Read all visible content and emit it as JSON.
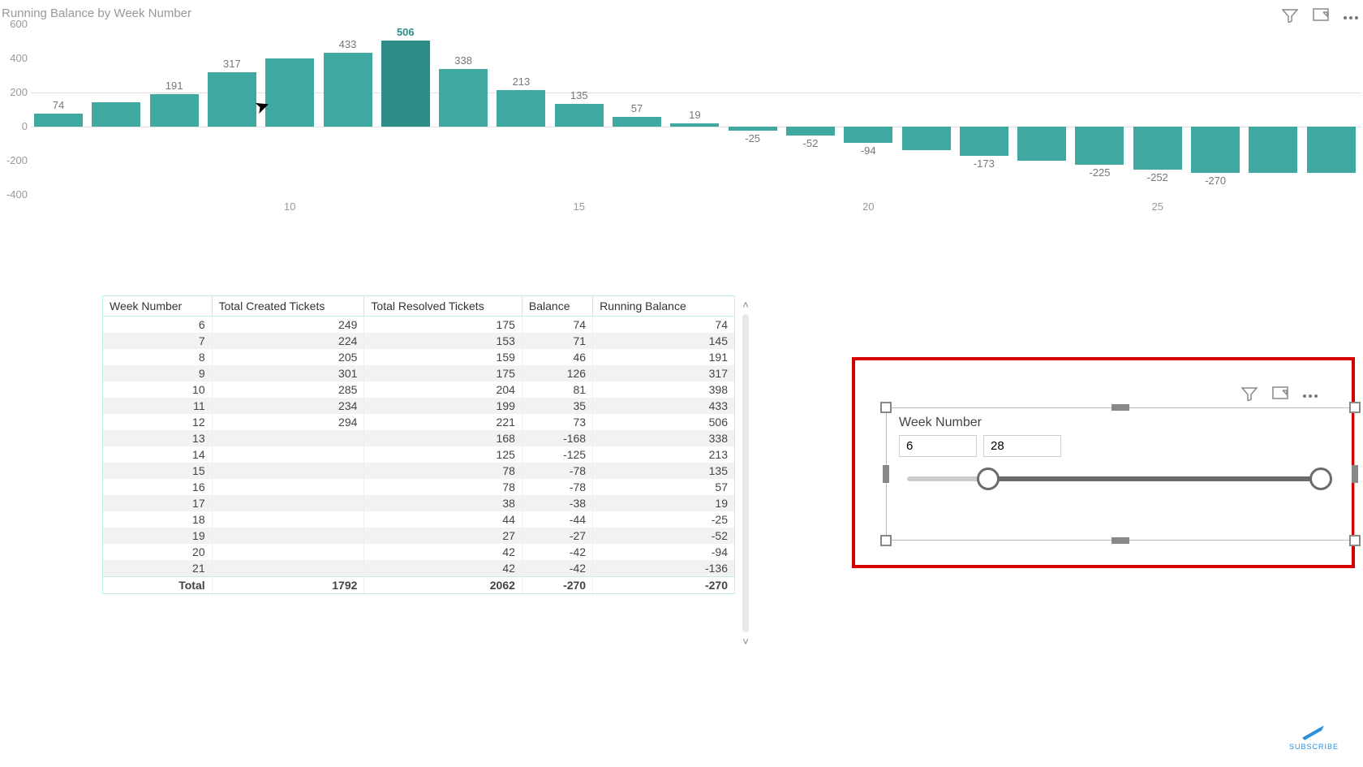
{
  "chart_data": {
    "type": "bar",
    "title": "Running Balance by Week Number",
    "xlabel": "",
    "ylabel": "",
    "ylim": [
      -400,
      600
    ],
    "y_ticks": [
      600,
      400,
      200,
      0,
      -200,
      -400
    ],
    "x_ticks": [
      10,
      15,
      20,
      25
    ],
    "categories": [
      6,
      7,
      8,
      9,
      10,
      11,
      12,
      13,
      14,
      15,
      16,
      17,
      18,
      19,
      20,
      21,
      22,
      23,
      24,
      25,
      26,
      27,
      28
    ],
    "values": [
      74,
      145,
      191,
      317,
      398,
      433,
      506,
      338,
      213,
      135,
      57,
      19,
      -25,
      -52,
      -94,
      -136,
      -173,
      -200,
      -225,
      -252,
      -270,
      -270,
      -270
    ],
    "data_labels": [
      "74",
      "",
      "191",
      "317",
      "",
      "433",
      "506",
      "338",
      "213",
      "135",
      "57",
      "19",
      "-25",
      "-52",
      "-94",
      "",
      "-173",
      "",
      "-225",
      "-252",
      "-270",
      "",
      ""
    ],
    "highlight_index": 6
  },
  "table": {
    "headers": [
      "Week Number",
      "Total Created Tickets",
      "Total Resolved Tickets",
      "Balance",
      "Running Balance"
    ],
    "rows": [
      {
        "week": 6,
        "created": 249,
        "resolved": 175,
        "balance": 74,
        "running": 74
      },
      {
        "week": 7,
        "created": 224,
        "resolved": 153,
        "balance": 71,
        "running": 145
      },
      {
        "week": 8,
        "created": 205,
        "resolved": 159,
        "balance": 46,
        "running": 191
      },
      {
        "week": 9,
        "created": 301,
        "resolved": 175,
        "balance": 126,
        "running": 317
      },
      {
        "week": 10,
        "created": 285,
        "resolved": 204,
        "balance": 81,
        "running": 398
      },
      {
        "week": 11,
        "created": 234,
        "resolved": 199,
        "balance": 35,
        "running": 433
      },
      {
        "week": 12,
        "created": 294,
        "resolved": 221,
        "balance": 73,
        "running": 506
      },
      {
        "week": 13,
        "created": null,
        "resolved": 168,
        "balance": -168,
        "running": 338
      },
      {
        "week": 14,
        "created": null,
        "resolved": 125,
        "balance": -125,
        "running": 213
      },
      {
        "week": 15,
        "created": null,
        "resolved": 78,
        "balance": -78,
        "running": 135
      },
      {
        "week": 16,
        "created": null,
        "resolved": 78,
        "balance": -78,
        "running": 57
      },
      {
        "week": 17,
        "created": null,
        "resolved": 38,
        "balance": -38,
        "running": 19
      },
      {
        "week": 18,
        "created": null,
        "resolved": 44,
        "balance": -44,
        "running": -25
      },
      {
        "week": 19,
        "created": null,
        "resolved": 27,
        "balance": -27,
        "running": -52
      },
      {
        "week": 20,
        "created": null,
        "resolved": 42,
        "balance": -42,
        "running": -94
      },
      {
        "week": 21,
        "created": null,
        "resolved": 42,
        "balance": -42,
        "running": -136
      }
    ],
    "total": {
      "label": "Total",
      "created": 1792,
      "resolved": 2062,
      "balance": -270,
      "running": -270
    }
  },
  "slicer": {
    "title": "Week Number",
    "min_value": "6",
    "max_value": "28"
  },
  "icons": {
    "filter": "filter-icon",
    "focus": "focus-mode-icon",
    "more": "more-options-icon"
  },
  "watermark": {
    "text": "SUBSCRIBE"
  }
}
